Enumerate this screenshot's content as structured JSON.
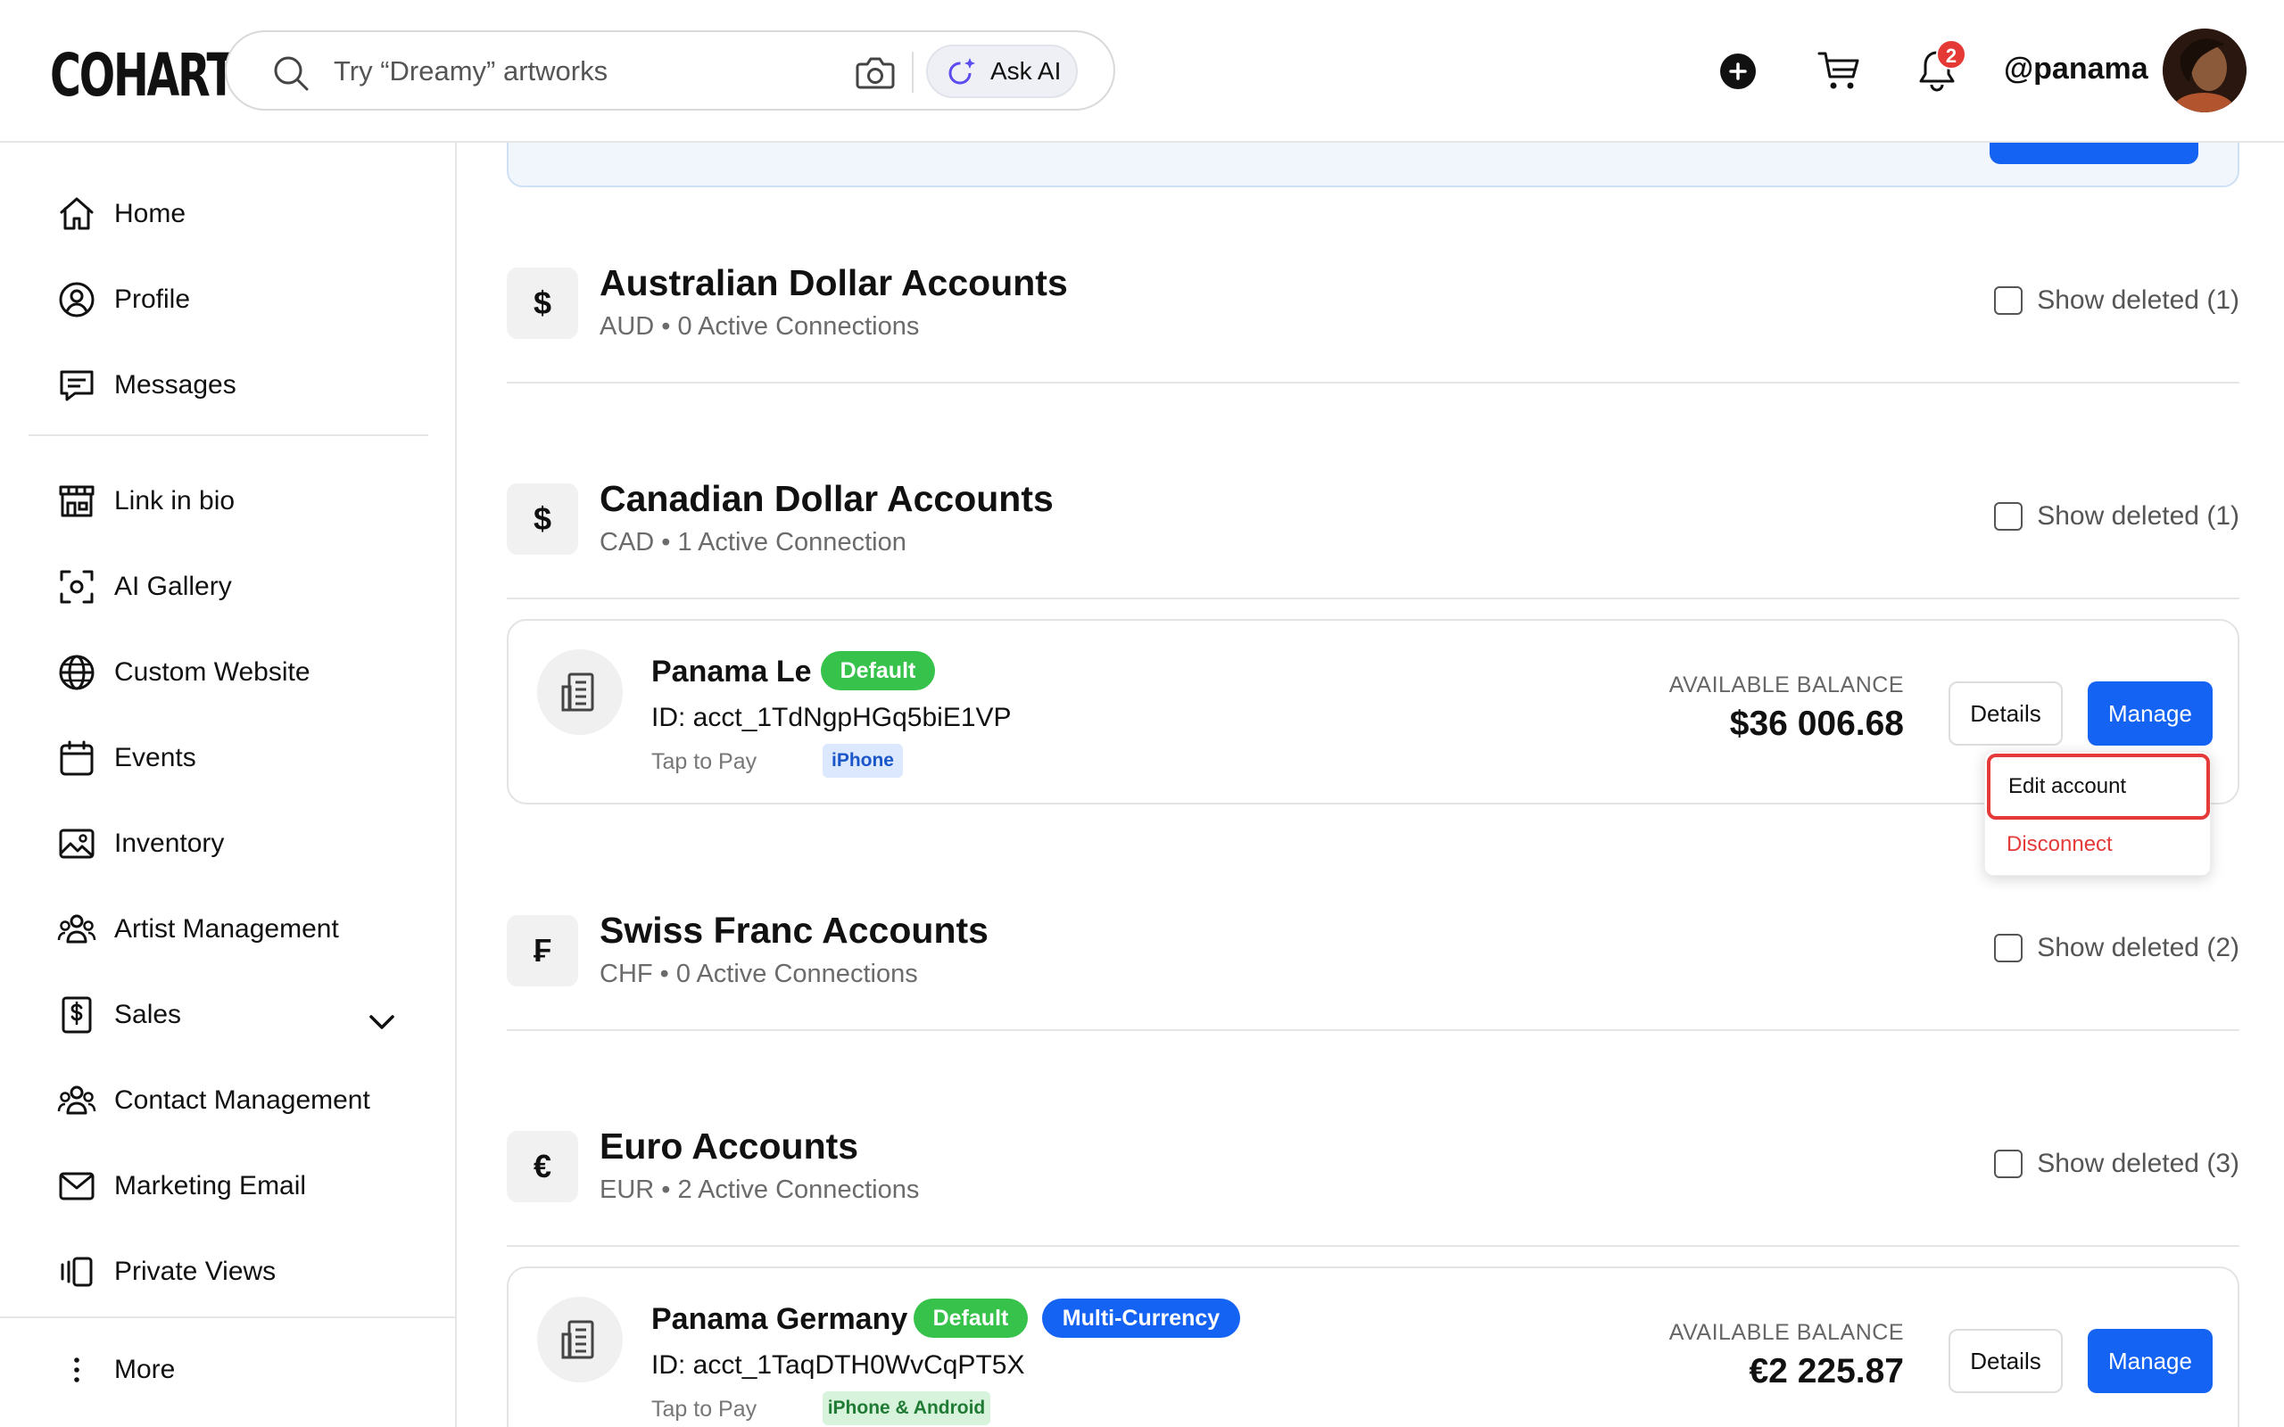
{
  "header": {
    "logo": "COHART",
    "search_placeholder": "Try “Dreamy” artworks",
    "ask_ai_label": "Ask AI",
    "notification_count": "2",
    "username": "@panama"
  },
  "sidebar": {
    "items": [
      {
        "label": "Home",
        "icon": "home-icon"
      },
      {
        "label": "Profile",
        "icon": "profile-icon"
      },
      {
        "label": "Messages",
        "icon": "messages-icon"
      },
      {
        "label": "Link in bio",
        "icon": "storefront-icon"
      },
      {
        "label": "AI Gallery",
        "icon": "ai-gallery-icon"
      },
      {
        "label": "Custom Website",
        "icon": "globe-icon"
      },
      {
        "label": "Events",
        "icon": "calendar-icon"
      },
      {
        "label": "Inventory",
        "icon": "image-icon"
      },
      {
        "label": "Artist Management",
        "icon": "people-icon"
      },
      {
        "label": "Sales",
        "icon": "dollar-doc-icon"
      },
      {
        "label": "Contact Management",
        "icon": "people-icon"
      },
      {
        "label": "Marketing Email",
        "icon": "mail-icon"
      },
      {
        "label": "Private Views",
        "icon": "private-views-icon"
      }
    ],
    "more_label": "More"
  },
  "sections": [
    {
      "symbol": "$",
      "title": "Australian Dollar Accounts",
      "subtitle": "AUD • 0 Active Connections",
      "show_deleted": "Show deleted (1)"
    },
    {
      "symbol": "$",
      "title": "Canadian Dollar Accounts",
      "subtitle": "CAD • 1 Active Connection",
      "show_deleted": "Show deleted (1)"
    },
    {
      "symbol": "₣",
      "title": "Swiss Franc Accounts",
      "subtitle": "CHF • 0 Active Connections",
      "show_deleted": "Show deleted (2)"
    },
    {
      "symbol": "€",
      "title": "Euro Accounts",
      "subtitle": "EUR • 2 Active Connections",
      "show_deleted": "Show deleted (3)"
    }
  ],
  "accounts": [
    {
      "name": "Panama Le",
      "badges": [
        "Default"
      ],
      "id": "ID: acct_1TdNgpHGq5biE1VP",
      "tap_label": "Tap to Pay",
      "device": "iPhone",
      "balance_label": "AVAILABLE BALANCE",
      "balance": "$36 006.68",
      "details_label": "Details",
      "manage_label": "Manage"
    },
    {
      "name": "Panama Germany",
      "badges": [
        "Default",
        "Multi-Currency"
      ],
      "id": "ID: acct_1TaqDTH0WvCqPT5X",
      "tap_label": "Tap to Pay",
      "device": "iPhone & Android",
      "balance_label": "AVAILABLE BALANCE",
      "balance": "€2 225.87",
      "details_label": "Details",
      "manage_label": "Manage"
    }
  ],
  "manage_menu": {
    "edit_label": "Edit account",
    "disconnect_label": "Disconnect"
  },
  "colors": {
    "accent": "#1463f3",
    "default_badge": "#37c24b",
    "danger": "#e53a3a"
  }
}
